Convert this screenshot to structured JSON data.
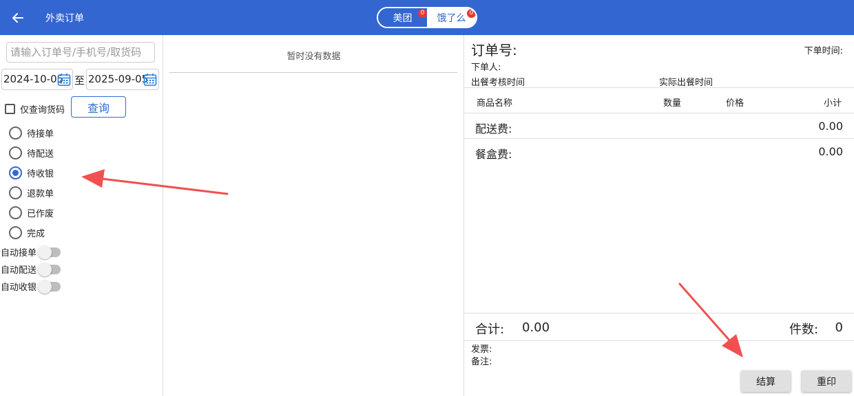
{
  "header": {
    "title": "外卖订单",
    "platforms": [
      {
        "label": "美团",
        "badge": "0"
      },
      {
        "label": "饿了么",
        "badge": "0"
      }
    ]
  },
  "filters": {
    "search_placeholder": "请输入订单号/手机号/取货码",
    "date_from": "2024-10-05",
    "date_to": "2025-09-05",
    "to_label": "至",
    "only_pickup_code_label": "仅查询货码",
    "query_button": "查询",
    "statuses": [
      {
        "label": "待接单",
        "selected": false
      },
      {
        "label": "待配送",
        "selected": false
      },
      {
        "label": "待收银",
        "selected": true
      },
      {
        "label": "退款单",
        "selected": false
      },
      {
        "label": "已作废",
        "selected": false
      },
      {
        "label": "完成",
        "selected": false
      }
    ],
    "toggles": [
      {
        "label": "自动接单",
        "on": false
      },
      {
        "label": "自动配送",
        "on": false
      },
      {
        "label": "自动收银",
        "on": false
      }
    ]
  },
  "list": {
    "empty_text": "暂时没有数据"
  },
  "detail": {
    "order_no_label": "订单号:",
    "order_time_label": "下单时间:",
    "orderer_label": "下单人:",
    "review_time_label": "出餐考核时间",
    "actual_time_label": "实际出餐时间",
    "columns": [
      "商品名称",
      "数量",
      "价格",
      "小计"
    ],
    "delivery_fee_label": "配送费:",
    "delivery_fee": "0.00",
    "box_fee_label": "餐盒费:",
    "box_fee": "0.00",
    "total_label": "合计:",
    "total": "0.00",
    "count_label": "件数:",
    "count": "0",
    "invoice_label": "发票:",
    "remark_label": "备注:",
    "checkout_button": "结算",
    "reprint_button": "重印"
  },
  "colors": {
    "header_bg": "#3366d0",
    "accent": "#2f6bd1",
    "badge": "#e53935",
    "annotation_arrow": "#f05050"
  }
}
